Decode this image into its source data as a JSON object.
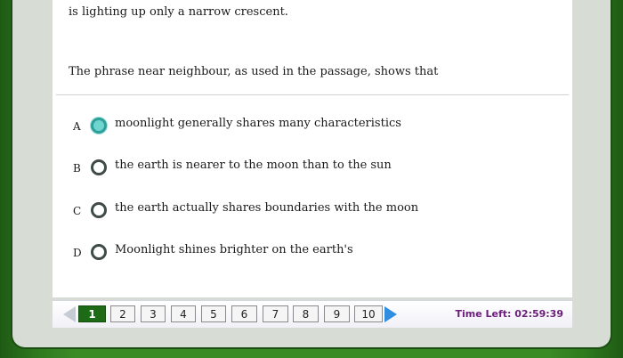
{
  "passage": {
    "text": "is lighting up only a narrow crescent."
  },
  "question": {
    "text": "The phrase near neighbour, as used in the passage, shows that"
  },
  "options": [
    {
      "letter": "A",
      "text": "moonlight generally shares many characteristics",
      "selected": true
    },
    {
      "letter": "B",
      "text": "the earth is nearer to the moon than to the sun",
      "selected": false
    },
    {
      "letter": "C",
      "text": "the earth actually shares boundaries with the moon",
      "selected": false
    },
    {
      "letter": "D",
      "text": "Moonlight shines brighter on the earth's",
      "selected": false
    }
  ],
  "pagination": {
    "pages": [
      "1",
      "2",
      "3",
      "4",
      "5",
      "6",
      "7",
      "8",
      "9",
      "10"
    ],
    "current": "1"
  },
  "timer": {
    "text": "Time Left: 02:59:39"
  },
  "colors": {
    "selected_radio": "#6fd6cf",
    "active_page": "#1d6b16",
    "timer": "#6b1f7a",
    "next_arrow": "#2f8ee0"
  }
}
